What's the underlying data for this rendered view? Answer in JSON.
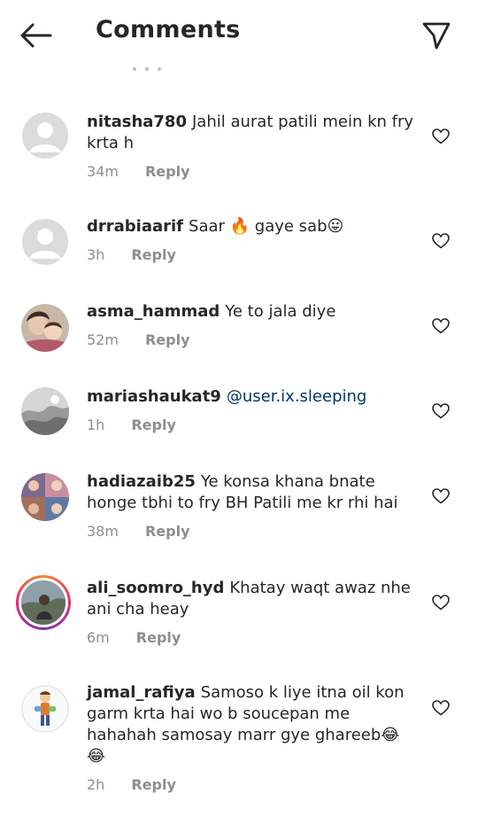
{
  "header": {
    "title": "Comments",
    "back_icon": "arrow-left-icon",
    "send_icon": "paper-plane-icon"
  },
  "comments": [
    {
      "username": "nitasha780",
      "text": "Jahil aurat patili mein kn fry krta h",
      "time": "34m",
      "reply": "Reply",
      "avatar": "default"
    },
    {
      "username": "drrabiaarif",
      "text_before": "Saar ",
      "emoji1": "🔥",
      "text_after": " gaye sab",
      "emoji2": "😛",
      "time": "3h",
      "reply": "Reply",
      "avatar": "default"
    },
    {
      "username": "asma_hammad",
      "text": "Ye to jala diye",
      "time": "52m",
      "reply": "Reply",
      "avatar": "photo"
    },
    {
      "username": "mariashaukat9",
      "mention": "@user.ix.sleeping",
      "time": "1h",
      "reply": "Reply",
      "avatar": "photo"
    },
    {
      "username": "hadiazaib25",
      "text": "Ye konsa khana bnate honge tbhi to fry BH Patili me kr rhi hai",
      "time": "38m",
      "reply": "Reply",
      "avatar": "photo"
    },
    {
      "username": "ali_soomro_hyd",
      "text": "Khatay waqt awaz nhe ani cha heay",
      "time": "6m",
      "reply": "Reply",
      "avatar": "story"
    },
    {
      "username": "jamal_rafiya",
      "text": "Samoso k liye itna oil kon garm krta hai wo b soucepan me hahahah samosay marr gye ghareeb",
      "emoji1": "😂",
      "emoji2": "😂",
      "time": "2h",
      "reply": "Reply",
      "avatar": "cartoon"
    }
  ],
  "colors": {
    "text": "#262626",
    "meta": "#8e8e8e",
    "mention": "#00376b"
  }
}
